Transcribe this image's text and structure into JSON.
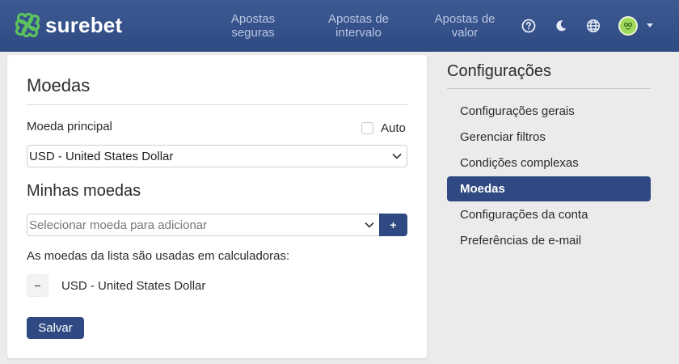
{
  "brand": {
    "name": "surebet",
    "accent": "#2f4a82",
    "logo_color": "#5cc35c"
  },
  "nav": [
    {
      "label": "Apostas\nseguras"
    },
    {
      "label": "Apostas de\nintervalo"
    },
    {
      "label": "Apostas de\nvalor"
    }
  ],
  "header_icons": [
    "help-icon",
    "moon-icon",
    "globe-icon",
    "avatar",
    "chevron-down-icon"
  ],
  "card": {
    "title": "Moedas",
    "main_currency_label": "Moeda principal",
    "auto_label": "Auto",
    "auto_checked": false,
    "main_currency_value": "USD - United States Dollar",
    "my_currencies_title": "Minhas moedas",
    "add_placeholder": "Selecionar moeda para adicionar",
    "add_button_label": "+",
    "info_text": "As moedas da lista são usadas em calculadoras:",
    "currencies": [
      {
        "remove_label": "−",
        "name": "USD - United States Dollar"
      }
    ],
    "save_label": "Salvar"
  },
  "sidebar": {
    "title": "Configurações",
    "items": [
      {
        "label": "Configurações gerais",
        "active": false
      },
      {
        "label": "Gerenciar filtros",
        "active": false
      },
      {
        "label": "Condições complexas",
        "active": false
      },
      {
        "label": "Moedas",
        "active": true
      },
      {
        "label": "Configurações da conta",
        "active": false
      },
      {
        "label": "Preferências de e-mail",
        "active": false
      }
    ]
  }
}
